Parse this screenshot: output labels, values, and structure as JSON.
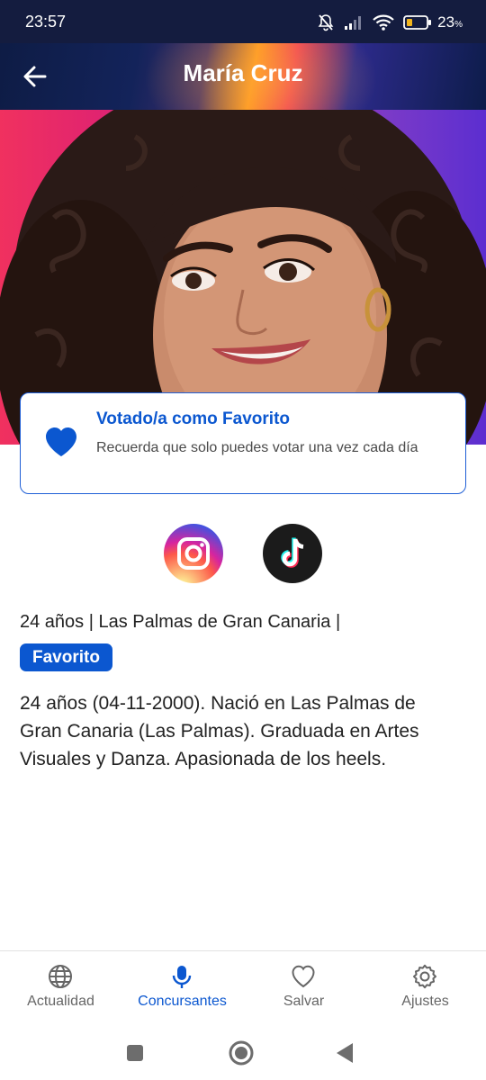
{
  "status_bar": {
    "time": "23:57",
    "battery": "23",
    "battery_unit": "%"
  },
  "app_bar": {
    "title": "María Cruz",
    "back_icon": "arrow-left-icon"
  },
  "vote_card": {
    "icon": "heart-icon",
    "title": "Votado/a como Favorito",
    "subtitle": "Recuerda que solo puedes votar una vez cada día"
  },
  "social": [
    {
      "name": "instagram",
      "icon": "instagram-icon"
    },
    {
      "name": "tiktok",
      "icon": "tiktok-icon"
    }
  ],
  "profile": {
    "meta": "24 años | Las Palmas de Gran Canaria |",
    "badge": "Favorito",
    "bio": "24 años (04-11-2000). Nació en Las Palmas de Gran Canaria (Las Palmas). Graduada en Artes Visuales y Danza. Apasionada de los heels."
  },
  "bottom_nav": {
    "items": [
      {
        "label": "Actualidad",
        "icon": "globe-icon",
        "active": false
      },
      {
        "label": "Concursantes",
        "icon": "microphone-icon",
        "active": true
      },
      {
        "label": "Salvar",
        "icon": "heart-outline-icon",
        "active": false
      },
      {
        "label": "Ajustes",
        "icon": "gear-icon",
        "active": false
      }
    ]
  },
  "colors": {
    "accent": "#0b57d0",
    "status_bar": "#141c3f"
  }
}
